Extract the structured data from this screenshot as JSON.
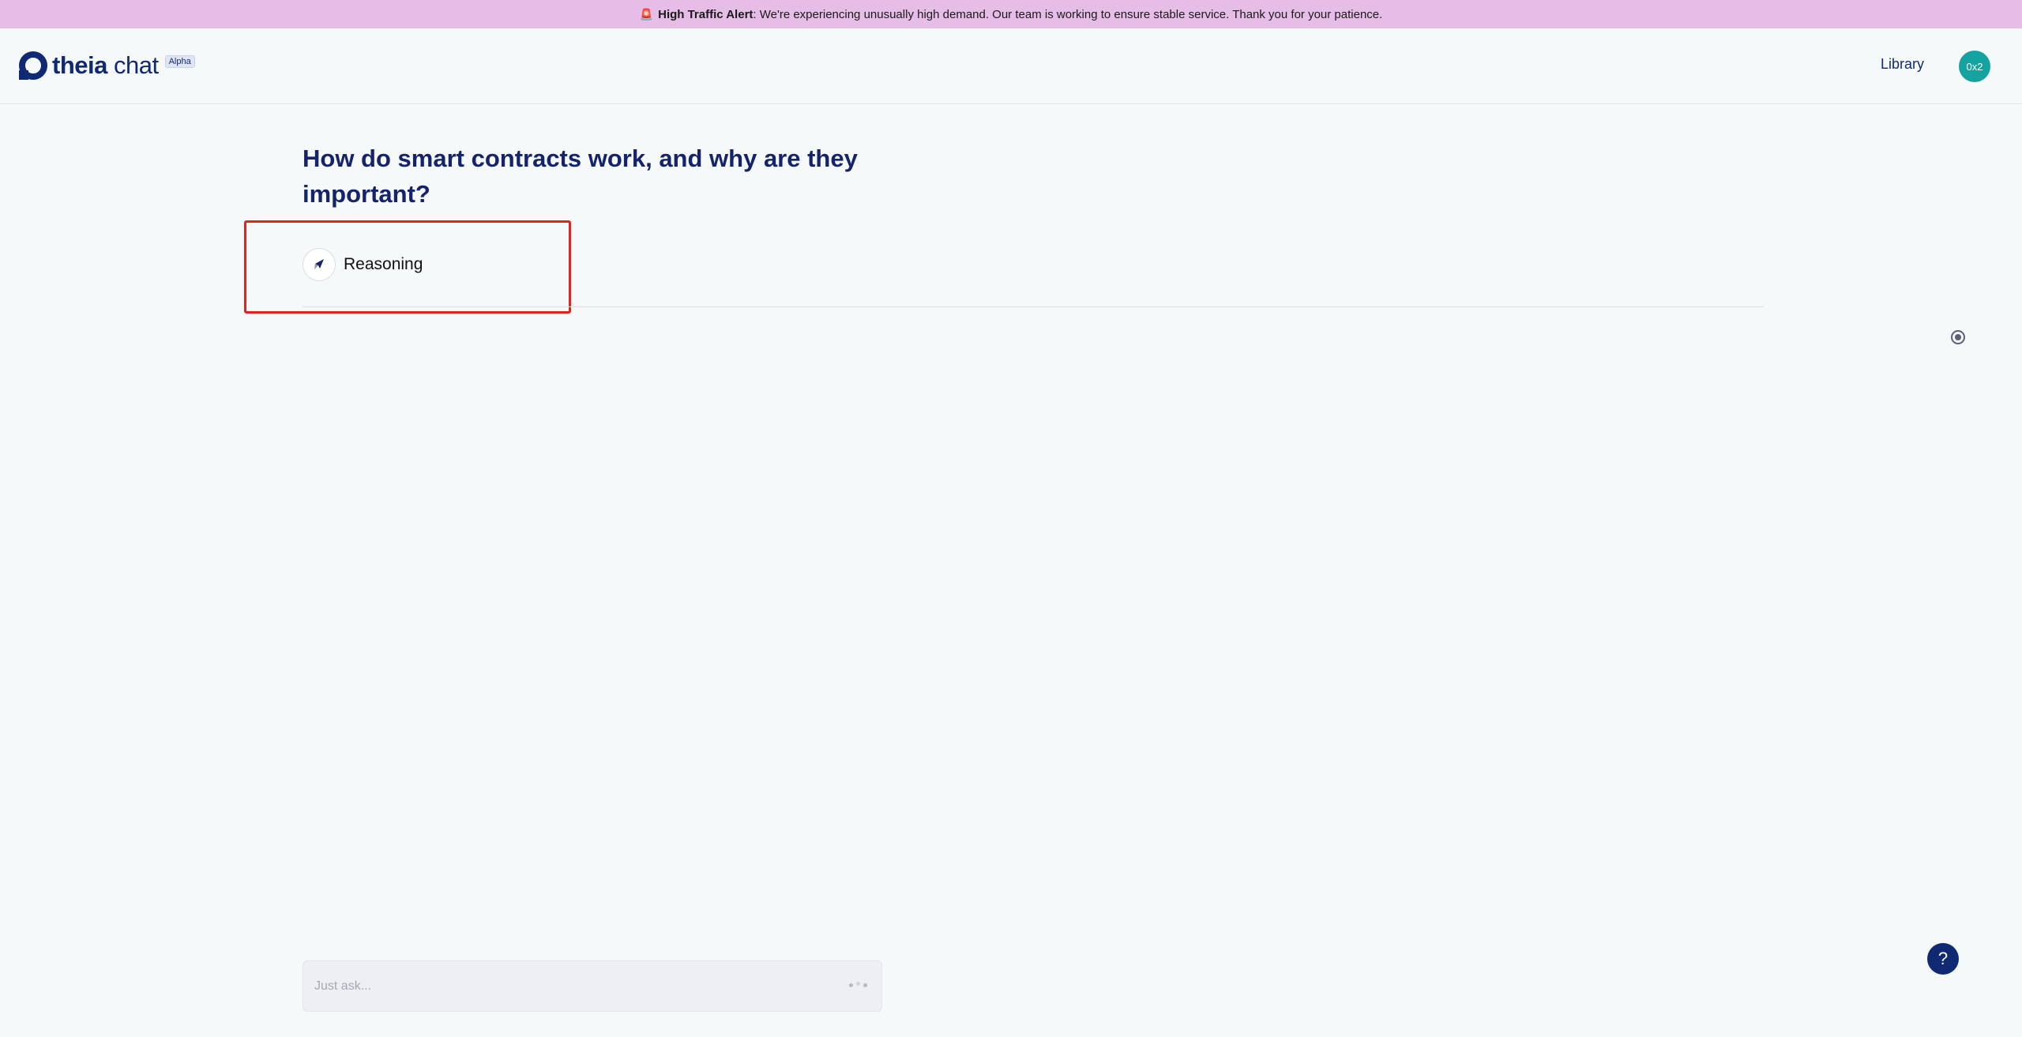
{
  "alert": {
    "icon": "siren-icon",
    "title": "High Traffic Alert",
    "message": ": We're experiencing unusually high demand. Our team is working to ensure stable service. Thank you for your patience."
  },
  "header": {
    "logo_bold": "theia",
    "logo_light": " chat",
    "badge": "Alpha",
    "library_label": "Library",
    "avatar_initials": "0x2"
  },
  "main": {
    "question": "How do smart contracts work, and why are they important?",
    "reasoning_label": "Reasoning"
  },
  "composer": {
    "placeholder": "Just ask..."
  },
  "help": {
    "label": "?"
  },
  "colors": {
    "brand": "#0f2a72",
    "alert_bg": "#e6bde6",
    "avatar_bg": "#14a3a0",
    "highlight": "#e0241f"
  }
}
